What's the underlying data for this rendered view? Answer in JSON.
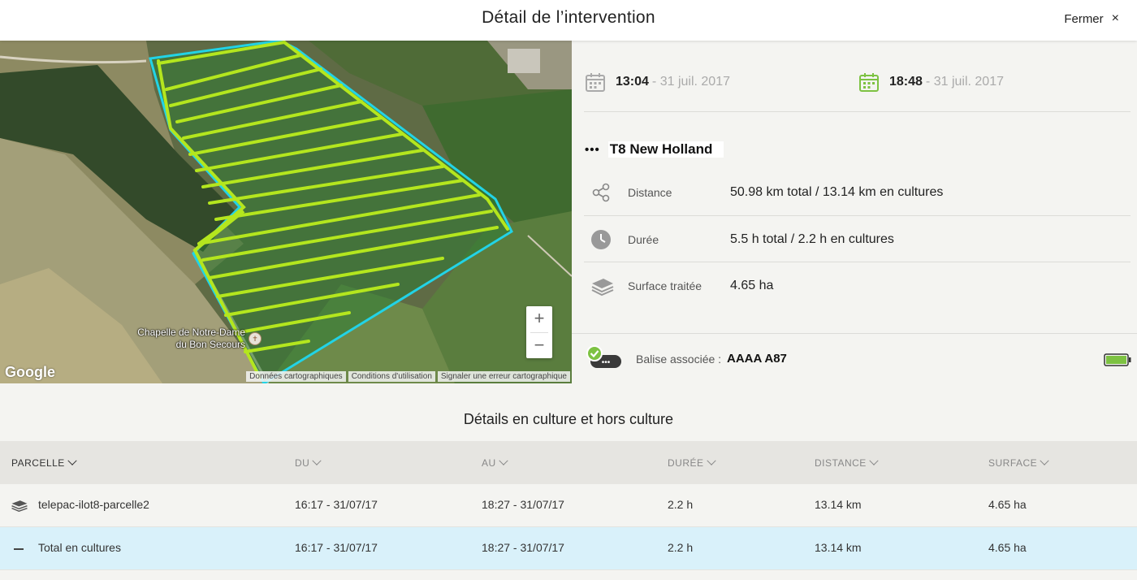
{
  "header": {
    "title": "Détail de l’intervention",
    "close_label": "Fermer",
    "close_icon": "×"
  },
  "map": {
    "place_label_line1": "Chapelle de Notre-Dame",
    "place_label_line2": "du Bon Secours",
    "zoom_in": "+",
    "zoom_out": "−",
    "google_logo": "Google",
    "footer": [
      "Données cartographiques",
      "Conditions d'utilisation",
      "Signaler une erreur cartographique"
    ],
    "colors": {
      "track": "#b4e61e",
      "boundary": "#22d3e6"
    }
  },
  "intervention": {
    "start": {
      "time": "13:04",
      "date": "- 31 juil. 2017",
      "icon": "calendar-icon",
      "color": "#aaaaaa"
    },
    "end": {
      "time": "18:48",
      "date": "- 31 juil. 2017",
      "icon": "calendar-icon",
      "color": "#7dc242"
    },
    "machine": {
      "dots": "•••",
      "name": "T8 New Holland"
    },
    "stats": [
      {
        "icon": "share-icon",
        "label": "Distance",
        "value": "50.98 km total / 13.14 km en cultures"
      },
      {
        "icon": "clock-icon",
        "label": "Durée",
        "value": "5.5 h total / 2.2 h en cultures"
      },
      {
        "icon": "layers-icon",
        "label": "Surface traitée",
        "value": "4.65 ha"
      }
    ],
    "balise": {
      "label": "Balise associée :",
      "value": "AAAA A87",
      "battery_level": 1.0,
      "status_color": "#7dc242"
    }
  },
  "details": {
    "title": "Détails en culture et hors culture",
    "columns": [
      "PARCELLE",
      "DU",
      "AU",
      "DURÉE",
      "DISTANCE",
      "SURFACE"
    ],
    "rows": [
      {
        "type": "parcel",
        "name": "telepac-ilot8-parcelle2",
        "du": "16:17 - 31/07/17",
        "au": "18:27 - 31/07/17",
        "duree": "2.2 h",
        "distance": "13.14 km",
        "surface": "4.65 ha"
      },
      {
        "type": "total",
        "name": "Total en cultures",
        "du": "16:17 - 31/07/17",
        "au": "18:27 - 31/07/17",
        "duree": "2.2 h",
        "distance": "13.14 km",
        "surface": "4.65 ha"
      }
    ]
  }
}
